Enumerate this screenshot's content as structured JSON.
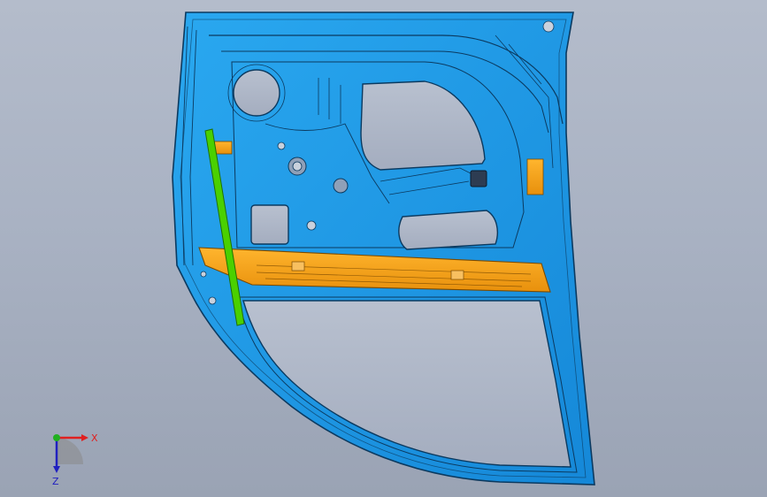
{
  "viewport": {
    "background_top": "#b4bccb",
    "background_bottom": "#9aa3b4"
  },
  "model": {
    "panel_color": "#1e9be8",
    "panel_edge_color": "#0b3a60",
    "reinforcement_color": "#f4a01c",
    "rail_color": "#4ad000"
  },
  "triad": {
    "x_label": "X",
    "z_label": "Z",
    "x_color": "#e02020",
    "y_color": "#20b020",
    "z_color": "#2020c0"
  }
}
